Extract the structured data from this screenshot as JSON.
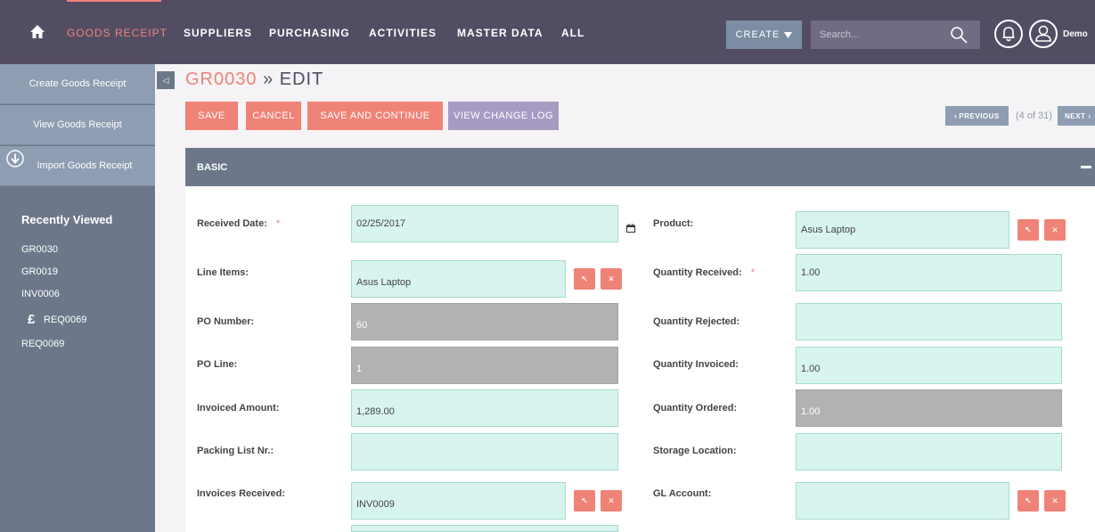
{
  "topnav": {
    "items": [
      "GOODS RECEIPT",
      "SUPPLIERS",
      "PURCHASING",
      "ACTIVITIES",
      "MASTER DATA",
      "ALL"
    ],
    "create_label": "CREATE",
    "search_placeholder": "Search...",
    "user_label": "Demo"
  },
  "sidebar": {
    "actions": [
      "Create Goods Receipt",
      "View Goods Receipt",
      "Import Goods Receipt"
    ],
    "recent_title": "Recently Viewed",
    "recent": [
      "GR0030",
      "GR0019",
      "INV0006",
      "REQ0069",
      "REQ0069"
    ]
  },
  "page": {
    "code": "GR0030",
    "separator": "»",
    "mode": "EDIT"
  },
  "buttons": {
    "save": "SAVE",
    "cancel": "CANCEL",
    "save_continue": "SAVE AND CONTINUE",
    "view_log": "VIEW CHANGE LOG"
  },
  "pager": {
    "previous": "PREVIOUS",
    "count": "(4 of 31)",
    "next": "NEXT"
  },
  "panel": {
    "title": "BASIC"
  },
  "form": {
    "received_date": {
      "label": "Received Date:",
      "value": "02/25/2017",
      "required": "*"
    },
    "line_items": {
      "label": "Line Items:",
      "value": "Asus Laptop"
    },
    "po_number": {
      "label": "PO Number:",
      "value": "60"
    },
    "po_line": {
      "label": "PO Line:",
      "value": "1"
    },
    "invoiced_amount": {
      "label": "Invoiced Amount:",
      "value": "1,289.00"
    },
    "packing_list": {
      "label": "Packing List Nr.:",
      "value": ""
    },
    "invoices_received": {
      "label": "Invoices Received:",
      "value": "INV0009"
    },
    "product": {
      "label": "Product:",
      "value": "Asus Laptop"
    },
    "quantity_received": {
      "label": "Quantity Received:",
      "value": "1.00",
      "required": "*"
    },
    "quantity_rejected": {
      "label": "Quantity Rejected:",
      "value": ""
    },
    "quantity_invoiced": {
      "label": "Quantity Invoiced:",
      "value": "1.00"
    },
    "quantity_ordered": {
      "label": "Quantity Ordered:",
      "value": "1.00"
    },
    "storage_location": {
      "label": "Storage Location:",
      "value": ""
    },
    "gl_account": {
      "label": "GL Account:",
      "value": ""
    }
  },
  "colors": {
    "topbar": "#534d64",
    "accent": "#f08377",
    "sidebar": "#6c788a",
    "field": "#d8f4ef"
  }
}
